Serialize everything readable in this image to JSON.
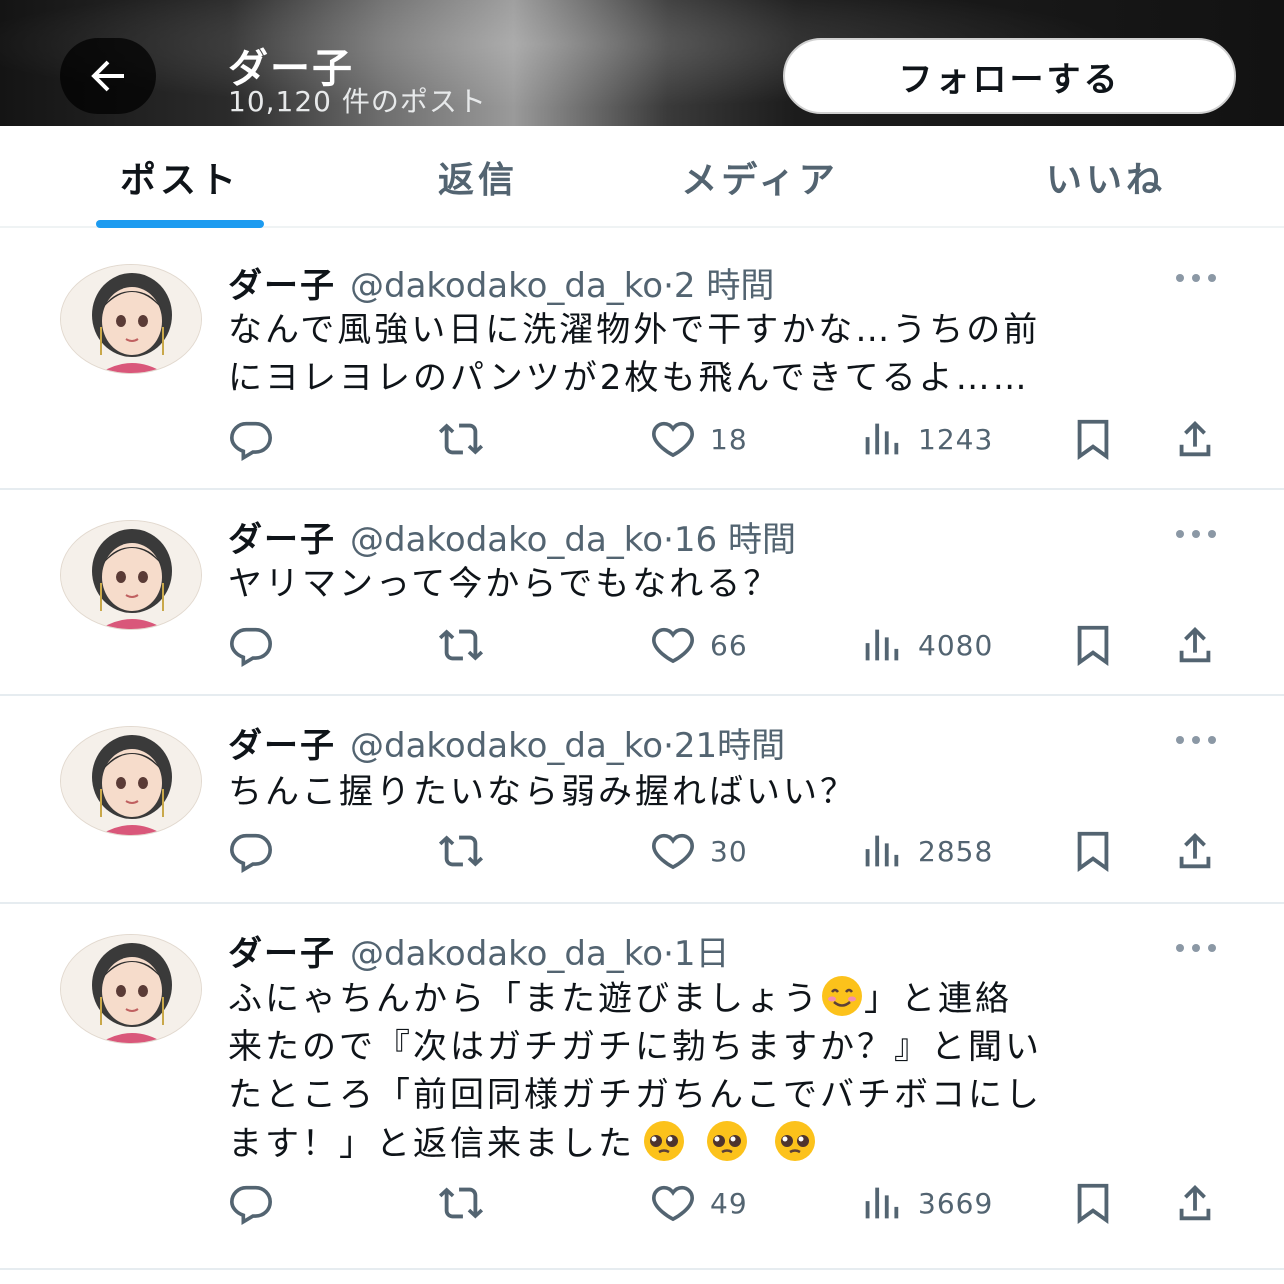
{
  "header": {
    "back_icon": "arrow-left-icon",
    "name": "ダー子",
    "post_count": "10,120 件のポスト",
    "follow_label": "フォローする"
  },
  "tabs": [
    {
      "label": "ポスト",
      "active": true
    },
    {
      "label": "返信",
      "active": false
    },
    {
      "label": "メディア",
      "active": false
    },
    {
      "label": "いいね",
      "active": false
    }
  ],
  "colors": {
    "accent": "#1d9bf0",
    "text": "#0f1419",
    "muted": "#536471"
  },
  "posts": [
    {
      "name": "ダー子",
      "handle": "@dakodako_da_ko",
      "dot": "·",
      "time": "2 時間",
      "text": "なんで風強い日に洗濯物外で干すかな…うちの前\nにヨレヨレのパンツが2枚も飛んできてるよ……",
      "likes": "18",
      "views": "1243"
    },
    {
      "name": "ダー子",
      "handle": "@dakodako_da_ko",
      "dot": "·",
      "time": "16 時間",
      "text": "ヤリマンって今からでもなれる？",
      "likes": "66",
      "views": "4080"
    },
    {
      "name": "ダー子",
      "handle": "@dakodako_da_ko",
      "dot": "·",
      "time": "21時間",
      "text": "ちんこ握りたいなら弱み握ればいい？",
      "likes": "30",
      "views": "2858"
    },
    {
      "name": "ダー子",
      "handle": "@dakodako_da_ko",
      "dot": "·",
      "time": "1日",
      "text_a": "ふにゃちんから「また遊びましょう",
      "text_b": "」と連絡\n来たので『次はガチガチに勃ちますか？』と聞い\nたところ「前回同様ガチガちんこでバチボコにし\nます！」と返信来ました",
      "likes": "49",
      "views": "3669"
    }
  ]
}
